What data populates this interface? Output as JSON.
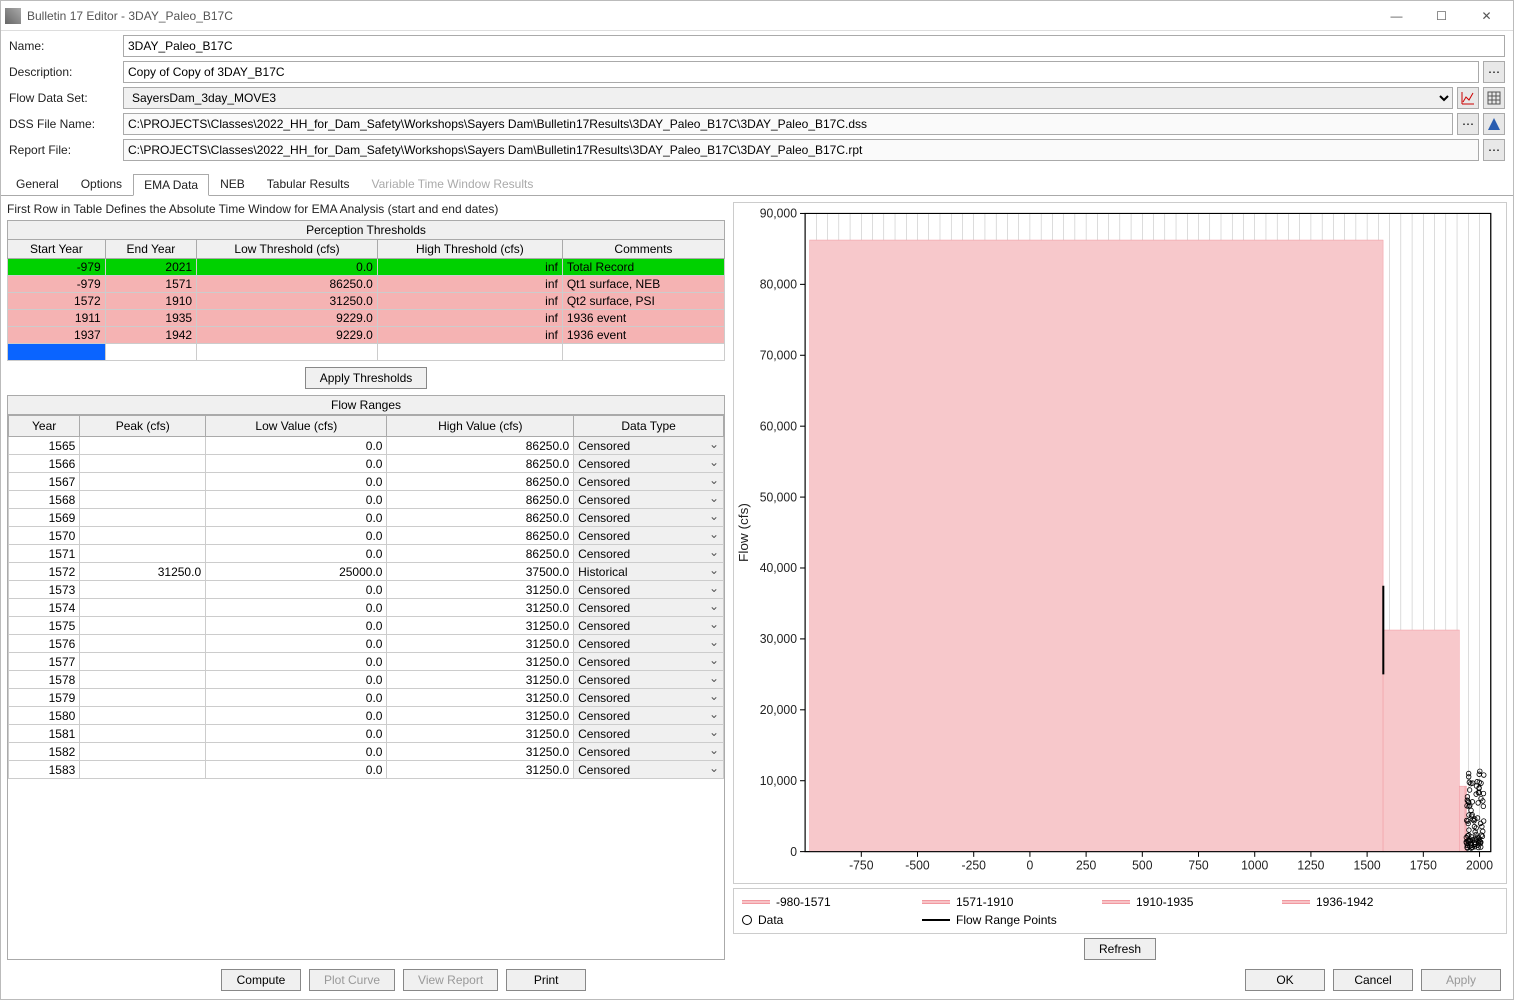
{
  "window": {
    "title": "Bulletin 17 Editor - 3DAY_Paleo_B17C"
  },
  "form": {
    "name_label": "Name:",
    "name": "3DAY_Paleo_B17C",
    "desc_label": "Description:",
    "desc": "Copy of Copy of 3DAY_B17C",
    "flowset_label": "Flow Data Set:",
    "flowset": "SayersDam_3day_MOVE3",
    "dss_label": "DSS File Name:",
    "dss": "C:\\PROJECTS\\Classes\\2022_HH_for_Dam_Safety\\Workshops\\Sayers Dam\\Bulletin17Results\\3DAY_Paleo_B17C\\3DAY_Paleo_B17C.dss",
    "rpt_label": "Report File:",
    "rpt": "C:\\PROJECTS\\Classes\\2022_HH_for_Dam_Safety\\Workshops\\Sayers Dam\\Bulletin17Results\\3DAY_Paleo_B17C\\3DAY_Paleo_B17C.rpt"
  },
  "tabs": [
    "General",
    "Options",
    "EMA Data",
    "NEB",
    "Tabular Results",
    "Variable Time Window Results"
  ],
  "active_tab": "EMA Data",
  "helper": "First Row in Table Defines the Absolute Time Window for EMA Analysis (start and end dates)",
  "pt": {
    "caption": "Perception Thresholds",
    "cols": [
      "Start Year",
      "End Year",
      "Low Threshold (cfs)",
      "High Threshold (cfs)",
      "Comments"
    ],
    "rows": [
      {
        "sy": "-979",
        "ey": "2021",
        "lo": "0.0",
        "hi": "inf",
        "c": "Total Record",
        "cls": "pt-row-green"
      },
      {
        "sy": "-979",
        "ey": "1571",
        "lo": "86250.0",
        "hi": "inf",
        "c": "Qt1 surface, NEB",
        "cls": "pt-row-pink"
      },
      {
        "sy": "1572",
        "ey": "1910",
        "lo": "31250.0",
        "hi": "inf",
        "c": "Qt2 surface, PSI",
        "cls": "pt-row-pink"
      },
      {
        "sy": "1911",
        "ey": "1935",
        "lo": "9229.0",
        "hi": "inf",
        "c": "1936 event",
        "cls": "pt-row-pink"
      },
      {
        "sy": "1937",
        "ey": "1942",
        "lo": "9229.0",
        "hi": "inf",
        "c": "1936 event",
        "cls": "pt-row-pink"
      },
      {
        "sy": "",
        "ey": "",
        "lo": "",
        "hi": "",
        "c": "",
        "cls": "pt-row-sel"
      }
    ]
  },
  "apply_label": "Apply Thresholds",
  "fr": {
    "caption": "Flow Ranges",
    "cols": [
      "Year",
      "Peak (cfs)",
      "Low Value (cfs)",
      "High Value (cfs)",
      "Data Type"
    ],
    "rows": [
      {
        "y": "1565",
        "p": "",
        "lo": "0.0",
        "hi": "86250.0",
        "dt": "Censored"
      },
      {
        "y": "1566",
        "p": "",
        "lo": "0.0",
        "hi": "86250.0",
        "dt": "Censored"
      },
      {
        "y": "1567",
        "p": "",
        "lo": "0.0",
        "hi": "86250.0",
        "dt": "Censored"
      },
      {
        "y": "1568",
        "p": "",
        "lo": "0.0",
        "hi": "86250.0",
        "dt": "Censored"
      },
      {
        "y": "1569",
        "p": "",
        "lo": "0.0",
        "hi": "86250.0",
        "dt": "Censored"
      },
      {
        "y": "1570",
        "p": "",
        "lo": "0.0",
        "hi": "86250.0",
        "dt": "Censored"
      },
      {
        "y": "1571",
        "p": "",
        "lo": "0.0",
        "hi": "86250.0",
        "dt": "Censored"
      },
      {
        "y": "1572",
        "p": "31250.0",
        "lo": "25000.0",
        "hi": "37500.0",
        "dt": "Historical"
      },
      {
        "y": "1573",
        "p": "",
        "lo": "0.0",
        "hi": "31250.0",
        "dt": "Censored"
      },
      {
        "y": "1574",
        "p": "",
        "lo": "0.0",
        "hi": "31250.0",
        "dt": "Censored"
      },
      {
        "y": "1575",
        "p": "",
        "lo": "0.0",
        "hi": "31250.0",
        "dt": "Censored"
      },
      {
        "y": "1576",
        "p": "",
        "lo": "0.0",
        "hi": "31250.0",
        "dt": "Censored"
      },
      {
        "y": "1577",
        "p": "",
        "lo": "0.0",
        "hi": "31250.0",
        "dt": "Censored"
      },
      {
        "y": "1578",
        "p": "",
        "lo": "0.0",
        "hi": "31250.0",
        "dt": "Censored"
      },
      {
        "y": "1579",
        "p": "",
        "lo": "0.0",
        "hi": "31250.0",
        "dt": "Censored"
      },
      {
        "y": "1580",
        "p": "",
        "lo": "0.0",
        "hi": "31250.0",
        "dt": "Censored"
      },
      {
        "y": "1581",
        "p": "",
        "lo": "0.0",
        "hi": "31250.0",
        "dt": "Censored"
      },
      {
        "y": "1582",
        "p": "",
        "lo": "0.0",
        "hi": "31250.0",
        "dt": "Censored"
      },
      {
        "y": "1583",
        "p": "",
        "lo": "0.0",
        "hi": "31250.0",
        "dt": "Censored"
      }
    ]
  },
  "chart_data": {
    "type": "area",
    "ylabel": "Flow (cfs)",
    "xlim": [
      -1000,
      2050
    ],
    "ylim": [
      0,
      90000
    ],
    "xticks": [
      -750,
      -500,
      -250,
      0,
      250,
      500,
      750,
      1000,
      1250,
      1500,
      1750,
      2000
    ],
    "yticks": [
      0,
      10000,
      20000,
      30000,
      40000,
      50000,
      60000,
      70000,
      80000,
      90000
    ],
    "ytick_labels": [
      "0",
      "10,000",
      "20,000",
      "30,000",
      "40,000",
      "50,000",
      "60,000",
      "70,000",
      "80,000",
      "90,000"
    ],
    "bands": [
      {
        "name": "-980-1571",
        "x0": -980,
        "x1": 1571,
        "y": 86250,
        "color": "#f7c8cb"
      },
      {
        "name": "1571-1910",
        "x0": 1571,
        "x1": 1910,
        "y": 31250,
        "color": "#f7c8cb"
      },
      {
        "name": "1910-1935",
        "x0": 1910,
        "x1": 1935,
        "y": 9229,
        "color": "#f7c8cb"
      },
      {
        "name": "1936-1942",
        "x0": 1937,
        "x1": 1942,
        "y": 9229,
        "color": "#f7c8cb"
      }
    ],
    "flow_range": {
      "x": 1572,
      "lo": 25000,
      "hi": 37500
    },
    "data_points_cluster": {
      "x0": 1940,
      "x1": 2020,
      "y_min": 500,
      "y_max": 12000,
      "count": 90
    }
  },
  "legend": {
    "items": [
      "-980-1571",
      "1571-1910",
      "1910-1935",
      "1936-1942"
    ],
    "data_label": "Data",
    "frp_label": "Flow Range Points"
  },
  "buttons": {
    "refresh": "Refresh",
    "compute": "Compute",
    "plot": "Plot Curve",
    "view": "View Report",
    "print": "Print",
    "ok": "OK",
    "cancel": "Cancel",
    "apply": "Apply"
  }
}
